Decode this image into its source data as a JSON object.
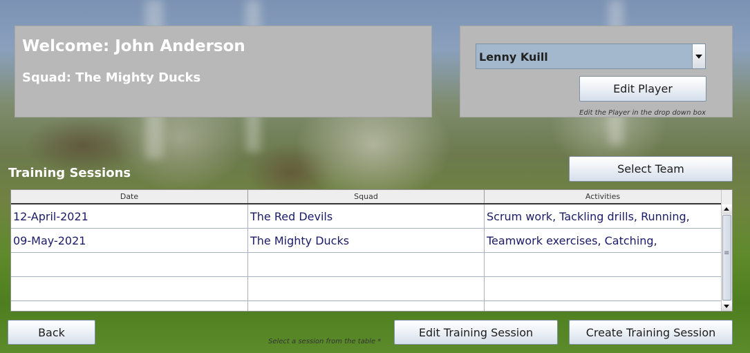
{
  "welcome": {
    "title": "Welcome: John Anderson",
    "squad": "Squad: The Mighty Ducks"
  },
  "player": {
    "selected": "Lenny Kuill",
    "edit_button": "Edit Player",
    "hint": "Edit the Player in the drop down box"
  },
  "training": {
    "title": "Training Sessions",
    "select_team_button": "Select Team"
  },
  "table": {
    "columns": [
      "Date",
      "Squad",
      "Activities"
    ],
    "rows": [
      [
        "12-April-2021",
        "The Red Devils",
        "Scrum work, Tackling drills, Running,"
      ],
      [
        "09-May-2021",
        "The Mighty Ducks",
        "Teamwork exercises, Catching,"
      ],
      [
        "",
        "",
        ""
      ],
      [
        "",
        "",
        ""
      ],
      [
        "",
        "",
        ""
      ]
    ]
  },
  "footer": {
    "back_button": "Back",
    "edit_session_button": "Edit Training Session",
    "create_session_button": "Create Training Session",
    "hint": "Select a session from the table *"
  },
  "colors": {
    "panel_bg": "#b8b8b8",
    "select_bg": "#a3b8cc",
    "table_text": "#1a1a66"
  },
  "icons": {
    "dropdown": "chevron-down-icon",
    "scroll_up": "arrow-up-icon",
    "scroll_down": "arrow-down-icon"
  }
}
